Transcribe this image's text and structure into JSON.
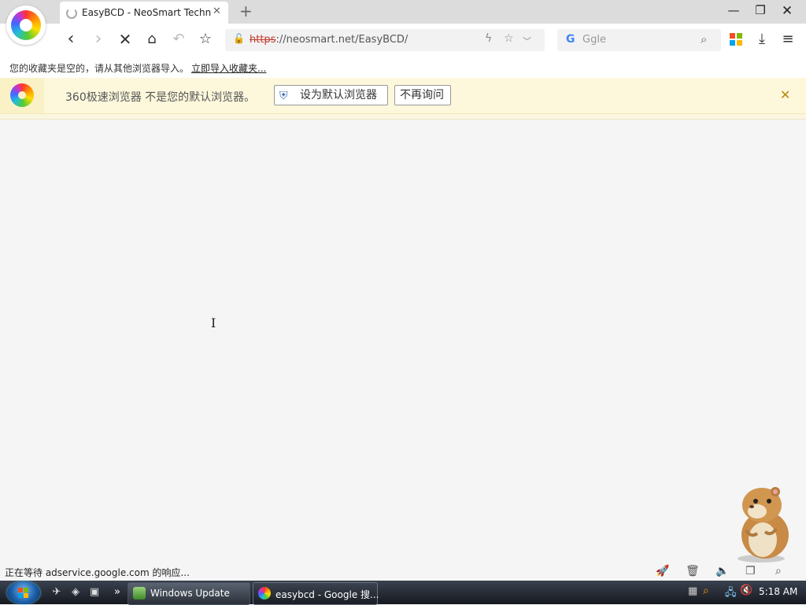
{
  "browser": {
    "tab_title": "EasyBCD - NeoSmart Technologies",
    "new_tab_icon": "plus-icon",
    "address_scheme": "https",
    "address_rest": "://neosmart.net/EasyBCD/",
    "search_placeholder": "Ggle",
    "search_engine_glyph": "G"
  },
  "bookmarks": {
    "empty_text": "您的收藏夹是空的，请从其他浏览器导入。",
    "import_link": "立即导入收藏夹..."
  },
  "notice": {
    "message": "360极速浏览器 不是您的默认浏览器。",
    "set_default_button": "设为默认浏览器",
    "dont_ask_button": "不再询问"
  },
  "status": {
    "text": "正在等待 adservice.google.com 的响应..."
  },
  "taskbar": {
    "windows_update_label": "Windows Update",
    "easybcd_label": "easybcd - Google 搜...",
    "clock": "5:18 AM",
    "overflow_glyph": "»"
  },
  "colors": {
    "notice_bg": "#fdf8dc",
    "https_strike": "#c0392b",
    "taskbar_top": "#3a4250"
  }
}
